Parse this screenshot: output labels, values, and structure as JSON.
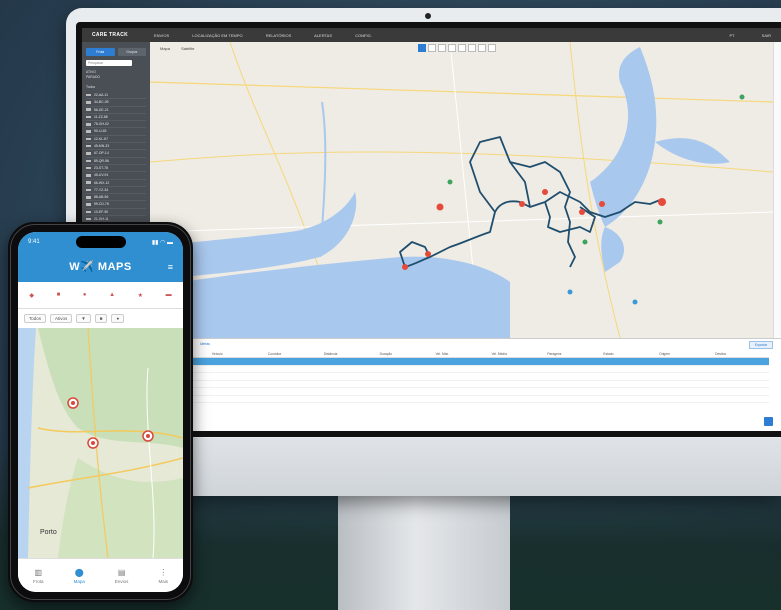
{
  "colors": {
    "accent": "#2d7dd2",
    "route": "#1f4e6e",
    "water": "#a9c8ee",
    "phone_header": "#2f8fd0"
  },
  "desktop": {
    "topbar": {
      "logo": "CARE TRACK",
      "menu": [
        "ENVIOS",
        "LOCALIZAÇÃO EM TEMPO",
        "RELATÓRIOS",
        "ALERTAS",
        "CONFIG."
      ],
      "right": [
        "PT",
        "SAIR"
      ]
    },
    "sidebar": {
      "tabs": [
        "Frota",
        "Grupos"
      ],
      "search_placeholder": "Pesquisar",
      "status": [
        "ATIVO",
        "PARADO"
      ],
      "list_header": "Todos",
      "vehicles": [
        "22-AA-11",
        "34-BC-09",
        "56-DE-21",
        "11-ZZ-88",
        "78-GH-02",
        "90-IJ-45",
        "12-KL-67",
        "45-MN-33",
        "67-OP-14",
        "89-QR-56",
        "23-ST-78",
        "45-UV-91",
        "66-WX-12",
        "77-YZ-34",
        "88-AB-56",
        "99-CD-78",
        "10-EF-90",
        "21-GH-11"
      ]
    },
    "map": {
      "tabs": [
        "Mapa",
        "Satélite"
      ],
      "toolbar_icons": [
        "pointer-icon",
        "route-icon",
        "layers-icon",
        "pin-icon",
        "ruler-icon",
        "zoom-icon",
        "fullscreen-icon",
        "print-icon"
      ],
      "right_rail_icons": [
        "zoom-in-icon",
        "zoom-out-icon",
        "street-view-icon"
      ]
    },
    "table": {
      "tabs": [
        "Envios",
        "Paragens",
        "Alertas"
      ],
      "export_label": "Exportar",
      "columns": [
        "Data",
        "Veículo",
        "Condutor",
        "Distância",
        "Duração",
        "Vel. Máx.",
        "Vel. Média",
        "Paragens",
        "Estado",
        "Origem",
        "Destino"
      ],
      "rows": [
        [
          "",
          "",
          "",
          "",
          "",
          "",
          "",
          "",
          "",
          "",
          ""
        ],
        [
          "",
          "",
          "",
          "",
          "",
          "",
          "",
          "",
          "",
          "",
          ""
        ],
        [
          "",
          "",
          "",
          "",
          "",
          "",
          "",
          "",
          "",
          "",
          ""
        ],
        [
          "",
          "",
          "",
          "",
          "",
          "",
          "",
          "",
          "",
          "",
          ""
        ],
        [
          "",
          "",
          "",
          "",
          "",
          "",
          "",
          "",
          "",
          "",
          ""
        ],
        [
          "",
          "",
          "",
          "",
          "",
          "",
          "",
          "",
          "",
          "",
          ""
        ]
      ]
    }
  },
  "phone": {
    "time": "9:41",
    "status": "▮▮ ◠ ▬",
    "title": "W✈️ MAPS",
    "filters": [
      "Todos",
      "Ativos",
      "▼",
      "■",
      "●"
    ],
    "nav": [
      {
        "label": "Frota",
        "icon": "chart-icon"
      },
      {
        "label": "Mapa",
        "icon": "pin-icon"
      },
      {
        "label": "Envios",
        "icon": "document-icon"
      },
      {
        "label": "Mais",
        "icon": "more-icon"
      }
    ],
    "map_city": "Porto"
  }
}
